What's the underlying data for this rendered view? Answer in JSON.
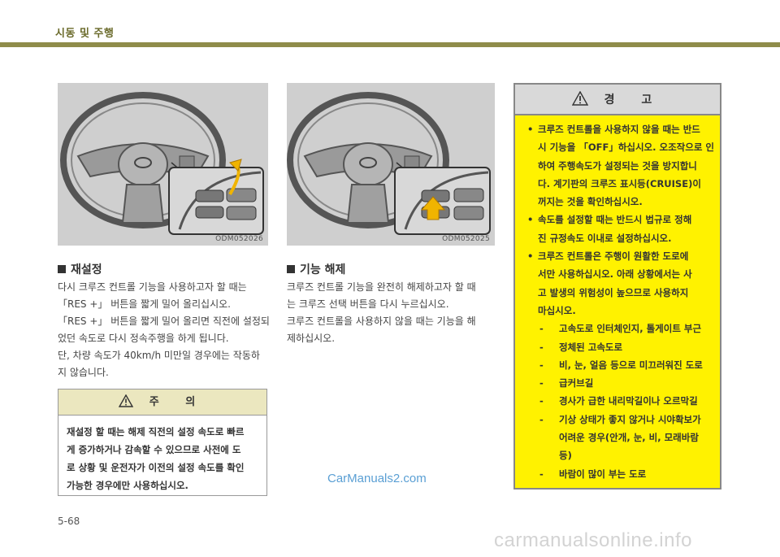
{
  "header": {
    "title": "시동 및 주행"
  },
  "figures": [
    {
      "code": "ODM052026"
    },
    {
      "code": "ODM052025"
    }
  ],
  "section_reset": {
    "heading": "재설정",
    "lines": [
      "다시 크루즈 컨트롤 기능을 사용하고자 할 때는",
      "「RES +」 버튼을 짧게 밀어 올리십시오.",
      "「RES +」 버튼을 짧게 밀어 올리면 직전에 설정되",
      "었던 속도로 다시 정속주행을 하게 됩니다.",
      "단, 차량 속도가 40km/h 미만일 경우에는 작동하",
      "지 않습니다."
    ]
  },
  "section_cancel": {
    "heading": "기능 해제",
    "lines": [
      "크루즈 컨트롤 기능을 완전히 해제하고자 할 때",
      "는 크루즈 선택 버튼을 다시 누르십시오.",
      "크루즈 컨트롤을 사용하지 않을 때는 기능을 해",
      "제하십시오."
    ]
  },
  "caution": {
    "title": "주 의",
    "lines": [
      "재설정 할 때는 해제 직전의 설정 속도로 빠르",
      "게 증가하거나 감속할 수 있으므로 사전에 도",
      "로 상황 및 운전자가 이전의 설정 속도를 확인",
      "가능한 경우에만 사용하십시오."
    ]
  },
  "warning": {
    "title": "경 고",
    "bullet_symbol": "•",
    "dash_symbol": "-",
    "bullets": [
      {
        "lines": [
          "크루즈 컨트롤을 사용하지 않을 때는 반드",
          "시 기능을 「OFF」하십시오. 오조작으로 인",
          "하여 주행속도가 설정되는 것을 방지합니",
          "다. 계기판의 크루즈 표시등(CRUISE)이",
          "꺼지는 것을 확인하십시오."
        ]
      },
      {
        "lines": [
          "속도를 설정할 때는 반드시 법규로 정해",
          "진 규정속도 이내로 설정하십시오."
        ]
      },
      {
        "lines": [
          "크루즈 컨트롤은 주행이 원활한 도로에",
          "서만 사용하십시오. 아래 상황에서는 사",
          "고 발생의 위험성이 높으므로 사용하지",
          "마십시오."
        ]
      }
    ],
    "subitems": [
      {
        "lines": [
          "고속도로 인터체인지, 톨게이트 부근"
        ]
      },
      {
        "lines": [
          "정체된 고속도로"
        ]
      },
      {
        "lines": [
          "비, 눈, 얼음 등으로 미끄러워진 도로"
        ]
      },
      {
        "lines": [
          "급커브길"
        ]
      },
      {
        "lines": [
          "경사가 급한 내리막길이나 오르막길"
        ]
      },
      {
        "lines": [
          "기상 상태가 좋지 않거나 시야확보가",
          "어려운 경우(안개, 눈, 비, 모래바람",
          "등)"
        ]
      },
      {
        "lines": [
          "바람이 많이 부는 도로"
        ]
      }
    ]
  },
  "watermark": "CarManuals2.com",
  "page_number": "5-68",
  "footer_watermark": "carmanualsonline.info",
  "colors": {
    "header_bar": "#8f8c4a",
    "caution_header": "#ebe7bf",
    "warning_bg": "#fff200",
    "warning_header": "#d9d9d9",
    "figure_bg": "#cfcfcf"
  }
}
